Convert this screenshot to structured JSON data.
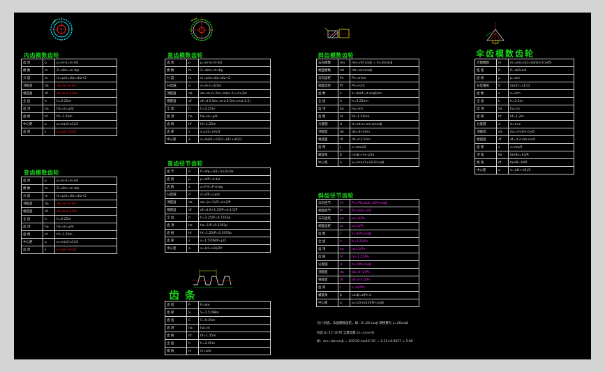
{
  "colors": {
    "background": "#000000",
    "frame": "#d4d4d4",
    "title": "#19d219",
    "cell": "#d8d8d8",
    "red": "#ff2020",
    "magenta": "#ff2bff",
    "cyan": "#00e5ff"
  },
  "titles": {
    "internal_module": "内齿模数齿轮",
    "variable_module": "变齿模数齿轮",
    "straight_module": "直齿模数齿轮",
    "straight_pitch": "直齿径节齿轮",
    "rack": "齿条",
    "helical_module": "斜齿模数齿轮",
    "helical_pitch": "斜齿径节齿轮",
    "bevel_module": "伞齿模数齿轮"
  },
  "tables": {
    "internal_module": [
      [
        "齿 周",
        "p",
        "p=m·π=m·d/z"
      ],
      [
        "模 数",
        "m",
        "Z=d/m=m·d/p"
      ],
      [
        "分 度",
        "m",
        "m=p/π=d/z=d/z+2"
      ],
      [
        "顶圆直",
        "da",
        "da=m·z+2m"
      ],
      [
        "根圆直",
        "df",
        "df=m·z-2.5m"
      ],
      [
        "全 齿",
        "h",
        "h=2.25m"
      ],
      [
        "齿 顶",
        "ha",
        "ha=m=p/π"
      ],
      [
        "齿 根",
        "hf",
        "hf=1.25m"
      ],
      [
        "中心距",
        "a",
        "a=m(z2-z1)/2"
      ],
      [
        "齿 厚",
        "s",
        "s=p/2=πm/2"
      ]
    ],
    "variable_module": [
      [
        "齿 周",
        "p",
        "p=m·π=m·d/z"
      ],
      [
        "模 数",
        "m",
        "Z=d/m=m·d/p"
      ],
      [
        "分 度",
        "m",
        "m=p/π=d/z=d/z+2"
      ],
      [
        "顶圆直",
        "da",
        "da=m·z+2m"
      ],
      [
        "根圆直",
        "df",
        "df=m·z-2.5m"
      ],
      [
        "全 齿",
        "h",
        "h=2.25m"
      ],
      [
        "齿 顶",
        "ha",
        "ha=m=p/π"
      ],
      [
        "齿 根",
        "hf",
        "hf=1.25m"
      ],
      [
        "中心距",
        "a",
        "a=m(z2-z1)/2"
      ],
      [
        "齿 厚",
        "s",
        "s=p/2=πm/2"
      ]
    ],
    "straight_module": [
      [
        "齿 周",
        "p",
        "p=m·π=m·d/z"
      ],
      [
        "模 数",
        "m",
        "Z=d/m=m·d/p"
      ],
      [
        "分 度",
        "m",
        "m=p/π=d/z=d/z+2"
      ],
      [
        "分度圆",
        "d",
        "d=m·z=d/2m"
      ],
      [
        "顶圆直",
        "da",
        "da=m·z+2m=m(z+2)=d+2m"
      ],
      [
        "根圆直",
        "df",
        "df=d-2.5m=m·z-2.5m=m(z-2.5)"
      ],
      [
        "全 齿",
        "h",
        "h=2.25m"
      ],
      [
        "齿 顶",
        "ha",
        "ha=m=p/π"
      ],
      [
        "齿 根",
        "hf",
        "hf=1.25m"
      ],
      [
        "齿 厚",
        "s",
        "s=p/2=πm/2"
      ],
      [
        "中心距",
        "a",
        "a=m(z1+z2)/2=(d1+d2)/2"
      ]
    ],
    "straight_pitch": [
      [
        "径 节",
        "P",
        "P=π/p=z/d=(z+2)/da"
      ],
      [
        "齿 周",
        "p",
        "p=π/P=π·d/z"
      ],
      [
        "齿 数",
        "z",
        "z=P·d=P·d·π/p"
      ],
      [
        "分度圆",
        "d",
        "d=z/P=z·p/π"
      ],
      [
        "顶圆直",
        "da",
        "da=(z+2)/P=d+2/P"
      ],
      [
        "根圆直",
        "df",
        "df=d-2×1.25/P=d-2.5/P"
      ],
      [
        "全 齿",
        "h",
        "h=2.25/P=0.7162p"
      ],
      [
        "齿 顶",
        "ha",
        "ha=1/P=0.3183p"
      ],
      [
        "齿 根",
        "hf",
        "hf=1.25/P=0.3979p"
      ],
      [
        "齿 厚",
        "s",
        "s=1.5708/P=p/2"
      ],
      [
        "中心距",
        "a",
        "a=(z1+z2)/2P"
      ]
    ],
    "rack": [
      [
        "齿 周",
        "P",
        "P=πm"
      ],
      [
        "齿 厚",
        "S",
        "S=1.5708m"
      ],
      [
        "齿 宽",
        "C",
        "C=0.25m"
      ],
      [
        "齿 顶",
        "ha",
        "ha=m"
      ],
      [
        "齿 根",
        "hf",
        "hf=1.25m"
      ],
      [
        "全 齿",
        "h",
        "h=2.25m"
      ],
      [
        "模 数",
        "m",
        "m=p/π"
      ]
    ],
    "helical_module": [
      [
        "法向模数",
        "mn",
        "mn=mt·cosβ = m=π/cosβ"
      ],
      [
        "端面模数",
        "mt",
        "mt=mn/cosβ"
      ],
      [
        "法向齿距",
        "Pn",
        "Pn=π·mn"
      ],
      [
        "端面齿距",
        "Pt",
        "Pt=π·mt"
      ],
      [
        "齿 数",
        "z",
        "z=d/mt=d·cosβ/mn"
      ],
      [
        "全 齿",
        "h",
        "h=2.25mn"
      ],
      [
        "齿 顶",
        "ha",
        "ha=mn"
      ],
      [
        "齿 根",
        "hf",
        "hf=1.25mn"
      ],
      [
        "分度圆",
        "d",
        "d=mt·z=mn·z/cosβ"
      ],
      [
        "顶圆直",
        "da",
        "da=d+2mn"
      ],
      [
        "根圆直",
        "df",
        "df=d-2.5mn"
      ],
      [
        "齿 厚",
        "s",
        "s=πmn/2"
      ],
      [
        "螺旋角",
        "β",
        "cosβ=mn·z/2a"
      ],
      [
        "中心距",
        "a",
        "a=mn(z1+z2)/2cosβ"
      ]
    ],
    "helical_pitch": [
      [
        "法向径节",
        "Pn",
        "Pn=Pt/cosβ=π/Pn·cosβ"
      ],
      [
        "端面径节",
        "Pt",
        "Pt=π/pt=z/d"
      ],
      [
        "法向齿距",
        "pn",
        "pn=π/Pn"
      ],
      [
        "端面齿距",
        "pt",
        "pt=π/Pt"
      ],
      [
        "齿 数",
        "z",
        "z=d·Pn·cosβ"
      ],
      [
        "全 齿",
        "h",
        "h=2.25/Pn"
      ],
      [
        "齿 顶",
        "ha",
        "ha=1/Pn"
      ],
      [
        "齿 根",
        "hf",
        "hf=1.25/Pn"
      ],
      [
        "分度圆",
        "d",
        "d=z/Pn·cosβ"
      ],
      [
        "顶圆直",
        "da",
        "da=d+2/Pn"
      ],
      [
        "根圆直",
        "df",
        "df=d-2.5/Pn"
      ],
      [
        "齿 厚",
        "s",
        "s=π/2Pn"
      ],
      [
        "螺旋角",
        "β",
        "cosβ=z/Pn·d"
      ],
      [
        "中心距",
        "a",
        "a=(z1+z2)/2Pn·cosβ"
      ]
    ],
    "bevel_module": [
      [
        "大端模数",
        "m",
        "m=p/π=d/z=da/(z+2cosδ)"
      ],
      [
        "锥 距",
        "R",
        "R=d/2sinδ"
      ],
      [
        "齿 周",
        "p",
        "p=πm"
      ],
      [
        "分度锥角",
        "δ",
        "tanδ1=z1/z2"
      ],
      [
        "齿 数",
        "z",
        "z=d/m"
      ],
      [
        "全 齿",
        "h",
        "h=2.2m"
      ],
      [
        "齿 顶",
        "ha",
        "ha=m"
      ],
      [
        "齿 根",
        "hf",
        "hf=1.2m"
      ],
      [
        "分度圆",
        "d",
        "d=m·z"
      ],
      [
        "顶圆直",
        "da",
        "da=d+2m·cosδ"
      ],
      [
        "根圆直",
        "df",
        "df=d-2.4m·cosδ"
      ],
      [
        "齿 厚",
        "s",
        "s=πm/2"
      ],
      [
        "顶 角",
        "θa",
        "tanθa=ha/R"
      ],
      [
        "根 角",
        "θf",
        "tanθf=hf/R"
      ],
      [
        "中心距",
        "a",
        "a=(d1+d2)/2"
      ]
    ]
  },
  "notes": {
    "line1": "[注] 斜齿、伞齿模数齿轮，如：Z=20·cosβ 即换算为 z=20cosβ",
    "line2": "斜齿 β=15°30′时 当量齿数 zv=z/cos³β",
    "line3": "如：mn=d/z·cosβ = 105/20·cos15°30′ = 5.25×0.9637 ≈ 5.06"
  }
}
